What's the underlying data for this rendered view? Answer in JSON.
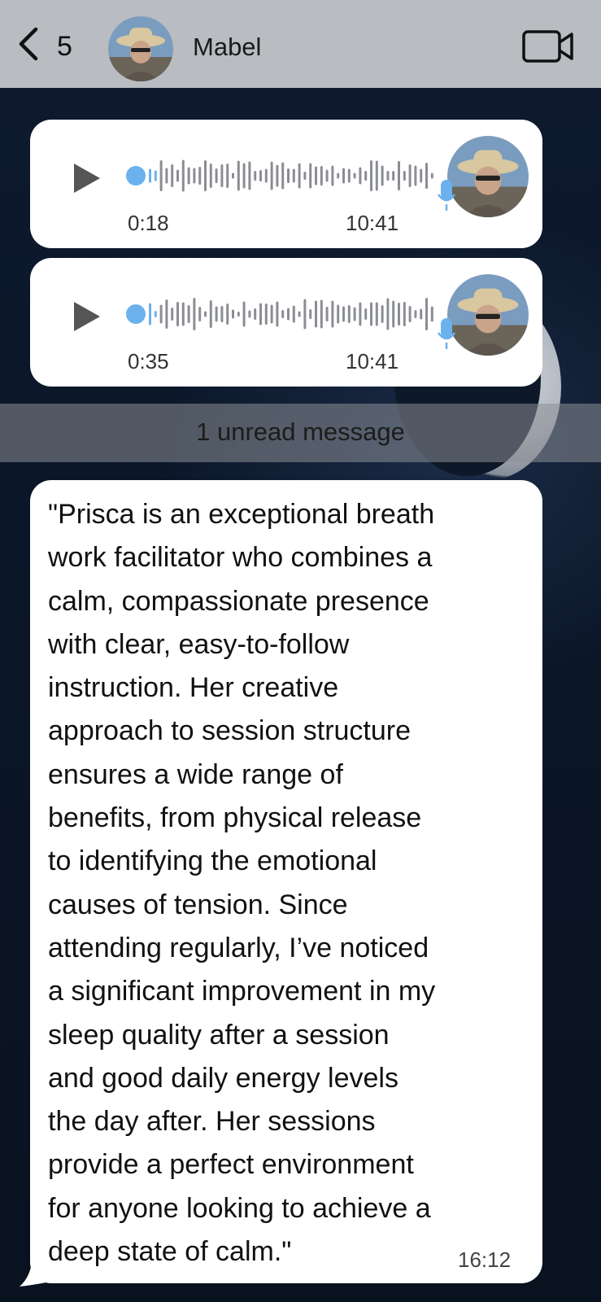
{
  "header": {
    "back_count": "5",
    "contact_name": "Mabel",
    "icons": {
      "back": "chevron-left-icon",
      "video": "video-camera-icon"
    }
  },
  "voice_messages": [
    {
      "duration": "0:18",
      "time": "10:41"
    },
    {
      "duration": "0:35",
      "time": "10:41"
    }
  ],
  "unread_banner": "1 unread message",
  "text_message": {
    "lines": "\"Prisca is an exceptional breath\nwork facilitator who combines a\ncalm, compassionate presence\nwith clear, easy-to-follow\ninstruction. Her creative\napproach to session structure\nensures a wide range of\nbenefits, from physical release\nto identifying the emotional\ncauses of tension. Since\nattending regularly, I’ve noticed\na significant improvement in my\nsleep quality after a session\nand good daily energy levels\nthe day after. Her sessions\nprovide a perfect environment\nfor anyone looking to achieve a\ndeep state of calm.\"",
    "time": "16:12"
  },
  "colors": {
    "header_bg": "#b9bcc1",
    "bubble_bg": "#ffffff",
    "waveform_accent": "#6ab1ee",
    "waveform_bars": "#8a8d93"
  }
}
